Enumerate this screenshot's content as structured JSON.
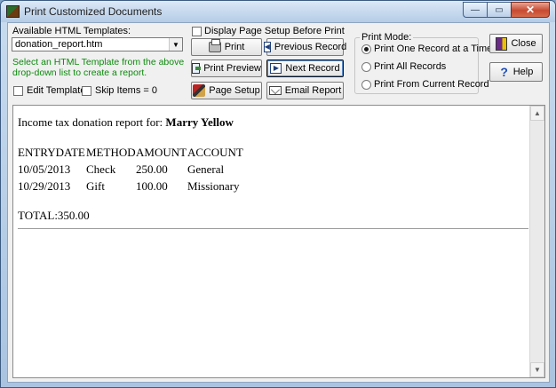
{
  "window": {
    "title": "Print Customized Documents",
    "buttons": {
      "minimize": "—",
      "maximize": "▭",
      "close": "✕"
    }
  },
  "templates": {
    "label": "Available HTML Templates:",
    "selected": "donation_report.htm",
    "hint_line1": "Select an HTML Template from the above",
    "hint_line2": "drop-down list to create a report.",
    "edit_template": "Edit Template",
    "skip_items": "Skip Items = 0"
  },
  "page_setup_checkbox": "Display Page Setup Before Print",
  "actions": {
    "print": "Print",
    "print_preview": "Print Preview",
    "page_setup": "Page Setup",
    "previous_record": "Previous Record",
    "next_record": "Next Record",
    "email_report": "Email Report",
    "close": "Close",
    "help": "Help"
  },
  "print_mode": {
    "title": "Print Mode:",
    "options": [
      {
        "label": "Print One Record at a Time",
        "selected": true
      },
      {
        "label": "Print All Records",
        "selected": false
      },
      {
        "label": "Print From Current Record",
        "selected": false
      }
    ]
  },
  "report": {
    "intro": "Income tax donation report for: ",
    "name": "Marry Yellow",
    "columns": [
      "ENTRYDATE",
      "METHOD",
      "AMOUNT",
      "ACCOUNT"
    ],
    "rows": [
      [
        "10/05/2013",
        "Check",
        "250.00",
        "General"
      ],
      [
        "10/29/2013",
        "Gift",
        "100.00",
        "Missionary"
      ]
    ],
    "total": "TOTAL:350.00"
  },
  "colors": {
    "hint_text": "#0a8a0a",
    "title_bar": "#b5cce6"
  },
  "icons": {
    "print": "printer-icon",
    "print_preview": "preview-icon",
    "page_setup": "page-setup-icon",
    "previous_record": "previous-record-icon",
    "next_record": "next-record-icon",
    "email_report": "email-icon",
    "close": "exit-door-icon",
    "help": "help-icon"
  }
}
